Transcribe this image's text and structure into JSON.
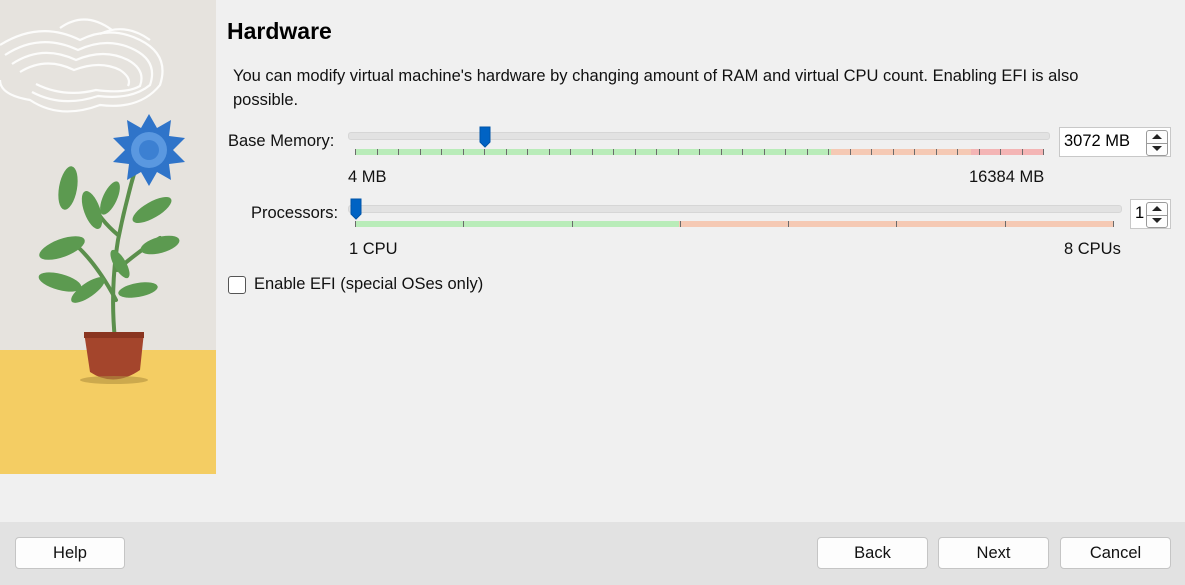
{
  "header": {
    "title": "Hardware",
    "description": "You can modify virtual machine's hardware by changing amount of RAM and virtual CPU count. Enabling EFI is also possible."
  },
  "memory": {
    "label": "Base Memory:",
    "min_label": "4 MB",
    "max_label": "16384 MB",
    "min_mb": 4,
    "max_mb": 16384,
    "value_mb": 3072,
    "spin_value": "3072 MB"
  },
  "processors": {
    "label": "Processors:",
    "min_label": "1 CPU",
    "max_label": "8 CPUs",
    "min": 1,
    "max": 8,
    "value": 1,
    "spin_value": "1"
  },
  "efi": {
    "label": "Enable EFI (special OSes only)",
    "checked": false
  },
  "buttons": {
    "help": "Help",
    "back": "Back",
    "next": "Next",
    "cancel": "Cancel"
  },
  "colors": {
    "accent": "#0063c4",
    "range_ok": "#b9ecb9",
    "range_warn": "#f5c9b4",
    "range_danger": "#f4b5b5"
  }
}
